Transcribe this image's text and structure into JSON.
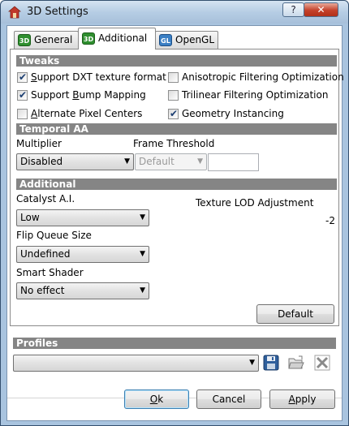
{
  "window": {
    "title": "3D Settings",
    "help_label": "?",
    "close_label": "✕"
  },
  "tabs": [
    {
      "label": "General",
      "icon": "3D",
      "icon_name": "3d-icon"
    },
    {
      "label": "Additional",
      "icon": "3D",
      "icon_name": "3d-icon"
    },
    {
      "label": "OpenGL",
      "icon": "GL",
      "icon_name": "gl-icon"
    }
  ],
  "tweaks": {
    "heading": "Tweaks",
    "checkboxes": [
      {
        "pre": "",
        "u": "S",
        "post": "upport DXT texture format",
        "checked": true
      },
      {
        "pre": "Support ",
        "u": "B",
        "post": "ump Mapping",
        "checked": true
      },
      {
        "pre": "",
        "u": "A",
        "post": "lternate Pixel Centers",
        "checked": false
      },
      {
        "pre": "Anisotropic Filtering Optimization",
        "u": "",
        "post": "",
        "checked": false
      },
      {
        "pre": "Trilinear Filtering Optimization",
        "u": "",
        "post": "",
        "checked": false
      },
      {
        "pre": "Geometry Instancing",
        "u": "",
        "post": "",
        "checked": true
      }
    ]
  },
  "temporal_aa": {
    "heading": "Temporal AA",
    "multiplier_label": "Multiplier",
    "multiplier_value": "Disabled",
    "frame_threshold_label": "Frame Threshold",
    "frame_threshold_value": "Default"
  },
  "additional": {
    "heading": "Additional",
    "catalyst_label": "Catalyst A.I.",
    "catalyst_value": "Low",
    "flip_queue_label": "Flip Queue Size",
    "flip_queue_value": "Undefined",
    "smart_shader_label": "Smart Shader",
    "smart_shader_value": "No effect",
    "lod_label": "Texture LOD Adjustment",
    "lod_value": "-2",
    "default_button": "Default"
  },
  "profiles": {
    "heading": "Profiles",
    "value": ""
  },
  "footer": {
    "ok": {
      "u": "O",
      "post": "k"
    },
    "cancel": "Cancel",
    "apply": {
      "u": "A",
      "post": "pply"
    }
  },
  "colors": {
    "section_header": "#858585",
    "accent": "#3c7fb1",
    "title_bar": "#b6cde4"
  }
}
